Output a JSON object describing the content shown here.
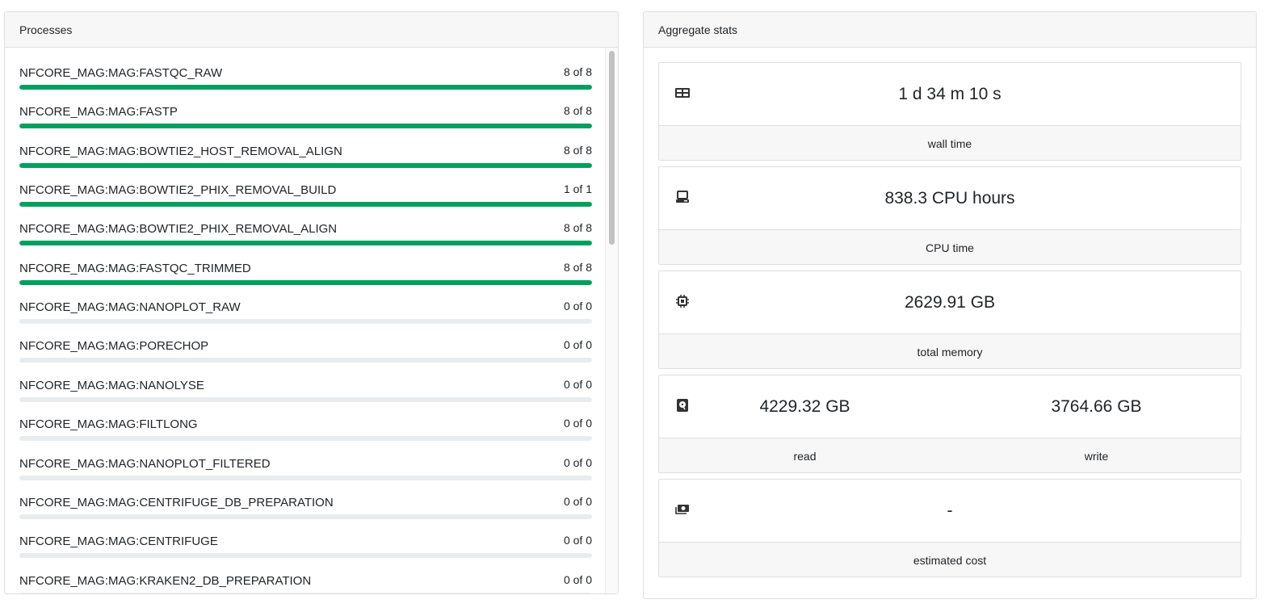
{
  "processes": {
    "title": "Processes",
    "items": [
      {
        "name": "NFCORE_MAG:MAG:FASTQC_RAW",
        "count": "8 of 8",
        "progress": 1.0
      },
      {
        "name": "NFCORE_MAG:MAG:FASTP",
        "count": "8 of 8",
        "progress": 1.0
      },
      {
        "name": "NFCORE_MAG:MAG:BOWTIE2_HOST_REMOVAL_ALIGN",
        "count": "8 of 8",
        "progress": 1.0
      },
      {
        "name": "NFCORE_MAG:MAG:BOWTIE2_PHIX_REMOVAL_BUILD",
        "count": "1 of 1",
        "progress": 1.0
      },
      {
        "name": "NFCORE_MAG:MAG:BOWTIE2_PHIX_REMOVAL_ALIGN",
        "count": "8 of 8",
        "progress": 1.0
      },
      {
        "name": "NFCORE_MAG:MAG:FASTQC_TRIMMED",
        "count": "8 of 8",
        "progress": 1.0
      },
      {
        "name": "NFCORE_MAG:MAG:NANOPLOT_RAW",
        "count": "0 of 0",
        "progress": 0
      },
      {
        "name": "NFCORE_MAG:MAG:PORECHOP",
        "count": "0 of 0",
        "progress": 0
      },
      {
        "name": "NFCORE_MAG:MAG:NANOLYSE",
        "count": "0 of 0",
        "progress": 0
      },
      {
        "name": "NFCORE_MAG:MAG:FILTLONG",
        "count": "0 of 0",
        "progress": 0
      },
      {
        "name": "NFCORE_MAG:MAG:NANOPLOT_FILTERED",
        "count": "0 of 0",
        "progress": 0
      },
      {
        "name": "NFCORE_MAG:MAG:CENTRIFUGE_DB_PREPARATION",
        "count": "0 of 0",
        "progress": 0
      },
      {
        "name": "NFCORE_MAG:MAG:CENTRIFUGE",
        "count": "0 of 0",
        "progress": 0
      },
      {
        "name": "NFCORE_MAG:MAG:KRAKEN2_DB_PREPARATION",
        "count": "0 of 0",
        "progress": 0
      }
    ]
  },
  "aggregate": {
    "title": "Aggregate stats",
    "wall_time": {
      "value": "1 d 34 m 10 s",
      "label": "wall time",
      "icon": "table-icon"
    },
    "cpu_time": {
      "value": "838.3 CPU hours",
      "label": "CPU time",
      "icon": "computer-icon"
    },
    "memory": {
      "value": "2629.91 GB",
      "label": "total memory",
      "icon": "chip-icon"
    },
    "io": {
      "read_value": "4229.32 GB",
      "write_value": "3764.66 GB",
      "read_label": "read",
      "write_label": "write",
      "icon": "harddisk-icon"
    },
    "cost": {
      "value": "-",
      "label": "estimated cost",
      "icon": "money-icon"
    }
  },
  "colors": {
    "progress_fill": "#00a15e",
    "progress_track": "#e9ecef",
    "header_bg": "#f7f7f7"
  }
}
